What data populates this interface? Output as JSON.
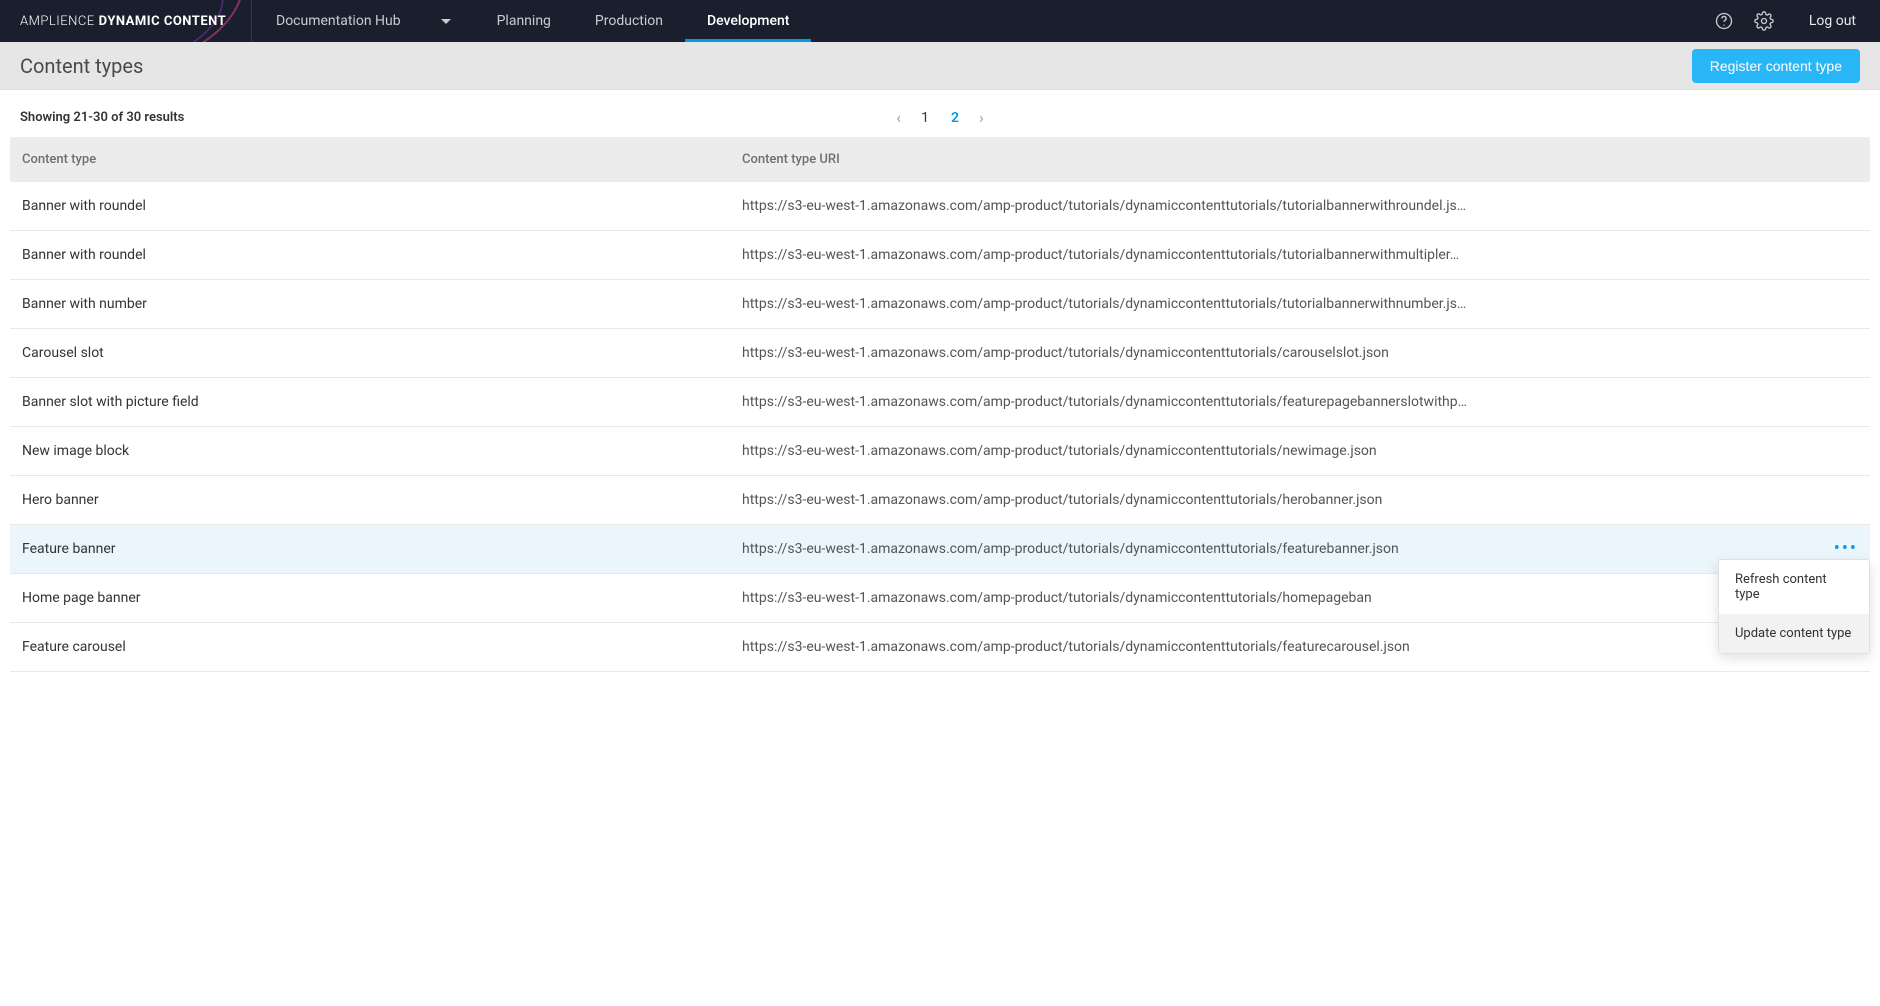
{
  "brand": {
    "light": "AMPLIENCE",
    "bold": "DYNAMIC CONTENT"
  },
  "hub_select": {
    "label": "Documentation Hub"
  },
  "nav": {
    "items": [
      {
        "label": "Planning",
        "active": false
      },
      {
        "label": "Production",
        "active": false
      },
      {
        "label": "Development",
        "active": true
      }
    ]
  },
  "topbar_right": {
    "logout": "Log out"
  },
  "page": {
    "title": "Content types",
    "primary_button": "Register content type"
  },
  "list_meta": {
    "results": "Showing 21-30 of 30 results",
    "pages": [
      "1",
      "2"
    ],
    "active_page_index": 1
  },
  "table": {
    "headers": {
      "name": "Content type",
      "uri": "Content type URI"
    },
    "rows": [
      {
        "name": "Banner with roundel",
        "uri": "https://s3-eu-west-1.amazonaws.com/amp-product/tutorials/dynamiccontenttutorials/tutorialbannerwithroundel.js…",
        "highlight": false
      },
      {
        "name": "Banner with roundel",
        "uri": "https://s3-eu-west-1.amazonaws.com/amp-product/tutorials/dynamiccontenttutorials/tutorialbannerwithmultipler…",
        "highlight": false
      },
      {
        "name": "Banner with number",
        "uri": "https://s3-eu-west-1.amazonaws.com/amp-product/tutorials/dynamiccontenttutorials/tutorialbannerwithnumber.js…",
        "highlight": false
      },
      {
        "name": "Carousel slot",
        "uri": "https://s3-eu-west-1.amazonaws.com/amp-product/tutorials/dynamiccontenttutorials/carouselslot.json",
        "highlight": false
      },
      {
        "name": "Banner slot with picture field",
        "uri": "https://s3-eu-west-1.amazonaws.com/amp-product/tutorials/dynamiccontenttutorials/featurepagebannerslotwithp…",
        "highlight": false
      },
      {
        "name": "New image block",
        "uri": "https://s3-eu-west-1.amazonaws.com/amp-product/tutorials/dynamiccontenttutorials/newimage.json",
        "highlight": false
      },
      {
        "name": "Hero banner",
        "uri": "https://s3-eu-west-1.amazonaws.com/amp-product/tutorials/dynamiccontenttutorials/herobanner.json",
        "highlight": false
      },
      {
        "name": "Feature banner",
        "uri": "https://s3-eu-west-1.amazonaws.com/amp-product/tutorials/dynamiccontenttutorials/featurebanner.json",
        "highlight": true
      },
      {
        "name": "Home page banner",
        "uri": "https://s3-eu-west-1.amazonaws.com/amp-product/tutorials/dynamiccontenttutorials/homepageban",
        "highlight": false
      },
      {
        "name": "Feature carousel",
        "uri": "https://s3-eu-west-1.amazonaws.com/amp-product/tutorials/dynamiccontenttutorials/featurecarousel.json",
        "highlight": false
      }
    ]
  },
  "context_menu": {
    "items": [
      {
        "label": "Refresh content type",
        "hover": false
      },
      {
        "label": "Update content type",
        "hover": true
      }
    ]
  }
}
